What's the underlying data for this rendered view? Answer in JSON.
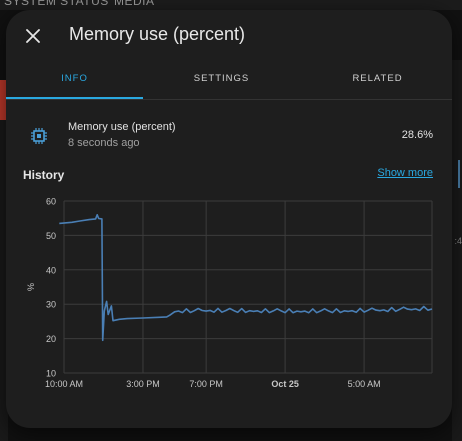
{
  "background": {
    "tabs": [
      "SYSTEM STATUS",
      "MEDIA"
    ]
  },
  "dialog": {
    "title": "Memory use (percent)",
    "close_icon": "close-icon",
    "tabs": [
      {
        "label": "INFO",
        "active": true
      },
      {
        "label": "SETTINGS",
        "active": false
      },
      {
        "label": "RELATED",
        "active": false
      }
    ],
    "entity": {
      "icon": "memory-chip-icon",
      "name": "Memory use (percent)",
      "last_changed": "8 seconds ago",
      "value": "28.6%"
    },
    "history": {
      "title": "History",
      "show_more": "Show more"
    }
  },
  "colors": {
    "accent": "#2aa8e0",
    "series": "#4a7fb5",
    "dialog_bg": "#1e1e1e",
    "grid": "#3c3c3c"
  },
  "chart_data": {
    "type": "line",
    "ylabel": "%",
    "ylim": [
      10,
      60
    ],
    "y_ticks": [
      10,
      20,
      30,
      40,
      50,
      60
    ],
    "x_ticks": [
      {
        "h": 0,
        "label": "10:00 AM",
        "bold": false
      },
      {
        "h": 5,
        "label": "3:00 PM",
        "bold": false
      },
      {
        "h": 9,
        "label": "7:00 PM",
        "bold": false
      },
      {
        "h": 14,
        "label": "Oct 25",
        "bold": true
      },
      {
        "h": 19,
        "label": "5:00 AM",
        "bold": false
      }
    ],
    "x_range_hours": [
      0,
      23.3
    ],
    "series": [
      {
        "values": [
          [
            -0.3,
            53.5
          ],
          [
            0.5,
            53.8
          ],
          [
            1.0,
            54.2
          ],
          [
            1.6,
            54.6
          ],
          [
            2.0,
            54.8
          ],
          [
            2.1,
            56.0
          ],
          [
            2.2,
            54.9
          ],
          [
            2.4,
            54.8
          ],
          [
            2.45,
            19.5
          ],
          [
            2.55,
            28.0
          ],
          [
            2.7,
            30.8
          ],
          [
            2.8,
            27.0
          ],
          [
            3.0,
            29.5
          ],
          [
            3.1,
            25.2
          ],
          [
            3.5,
            25.6
          ],
          [
            4.0,
            25.8
          ],
          [
            5.0,
            26.0
          ],
          [
            6.0,
            26.2
          ],
          [
            6.5,
            26.3
          ],
          [
            6.7,
            26.8
          ],
          [
            7.0,
            27.8
          ],
          [
            9.0,
            28.0
          ],
          [
            12.0,
            27.9
          ],
          [
            15.0,
            27.8
          ],
          [
            18.0,
            27.9
          ],
          [
            20.0,
            28.1
          ],
          [
            22.0,
            28.4
          ],
          [
            23.3,
            28.6
          ]
        ]
      }
    ]
  }
}
